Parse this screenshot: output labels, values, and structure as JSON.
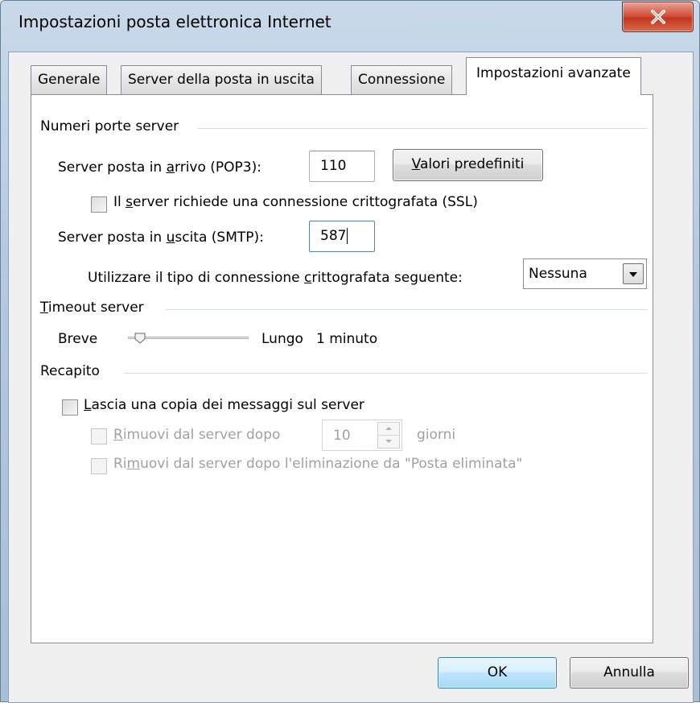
{
  "window": {
    "title": "Impostazioni posta elettronica Internet"
  },
  "tabs": [
    {
      "label": "Generale"
    },
    {
      "label": "Server della posta in uscita"
    },
    {
      "label": "Connessione"
    },
    {
      "label": "Impostazioni avanzate",
      "active": true
    }
  ],
  "ports": {
    "group_label": "Numeri porte server",
    "incoming_label_pre": "Server posta in ",
    "incoming_label_key": "a",
    "incoming_label_post": "rrivo (POP3):",
    "incoming_value": "110",
    "defaults_button_key": "V",
    "defaults_button_rest": "alori predefiniti",
    "ssl_label_pre": "Il ",
    "ssl_label_key": "s",
    "ssl_label_post": "erver richiede una connessione crittografata (SSL)",
    "ssl_checked": false,
    "outgoing_label_pre": "Server posta in ",
    "outgoing_label_key": "u",
    "outgoing_label_post": "scita (SMTP):",
    "outgoing_value": "587",
    "encryption_label_pre": "Utilizzare il tipo di connessione ",
    "encryption_label_key": "c",
    "encryption_label_post": "rittografata seguente:",
    "encryption_selected": "Nessuna"
  },
  "timeout": {
    "group_label_key": "T",
    "group_label_rest": "imeout server",
    "short_label": "Breve",
    "long_label": "Lungo",
    "value_text": "1 minuto",
    "slider_fraction": 0
  },
  "delivery": {
    "group_label": "Recapito",
    "leave_copy_key": "L",
    "leave_copy_rest": "ascia una copia dei messaggi sul server",
    "leave_copy_checked": false,
    "remove_after_key": "R",
    "remove_after_rest": "imuovi dal server dopo",
    "remove_after_value": "10",
    "days_label": "giorni",
    "remove_deleted_pre": "Ri",
    "remove_deleted_key": "m",
    "remove_deleted_post": "uovi dal server dopo l'eliminazione da \"Posta eliminata\""
  },
  "footer": {
    "ok_label": "OK",
    "cancel_label": "Annulla"
  },
  "icons": {
    "close": "close-icon",
    "dropdown": "chevron-down-icon",
    "spin_up": "spin-up-icon",
    "spin_down": "spin-down-icon"
  },
  "colors": {
    "close_button": "#c1361f",
    "frame": "#b4c9df",
    "default_button_border": "#3c7fb1"
  }
}
